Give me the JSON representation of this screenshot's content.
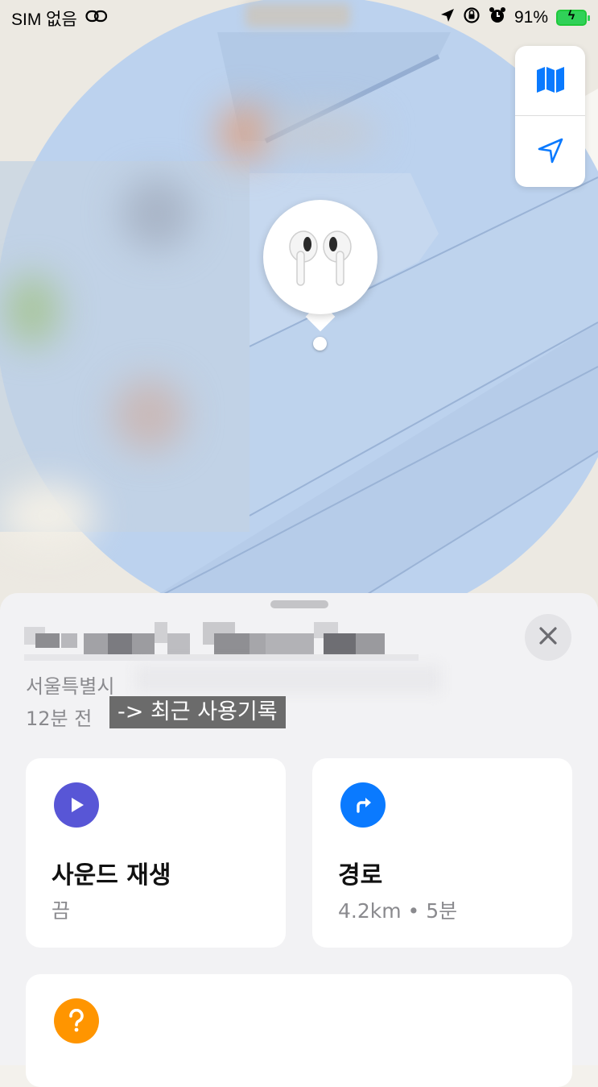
{
  "status_bar": {
    "carrier": "SIM 없음",
    "battery_percent": "91%",
    "icons": [
      "link-icon",
      "location-arrow-icon",
      "rotation-lock-icon",
      "alarm-icon",
      "battery-charging-icon"
    ]
  },
  "map": {
    "controls": [
      "map-icon",
      "location-arrow-icon"
    ],
    "pin_item": "airpods-icon",
    "accuracy_color": "#b7cfec"
  },
  "sheet": {
    "address": "서울특별시",
    "time_ago": "12분 전",
    "history_label": "-> 최근 사용기록",
    "cards": {
      "sound": {
        "title": "사운드 재생",
        "subtitle": "끔",
        "icon_color": "#5856d6"
      },
      "directions": {
        "title": "경로",
        "subtitle": "4.2km • 5분",
        "icon_color": "#0a7aff"
      },
      "help": {
        "icon_color": "#ff9500"
      }
    }
  }
}
